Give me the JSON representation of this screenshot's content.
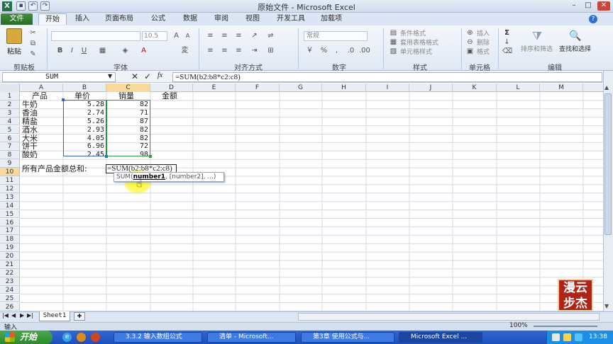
{
  "window": {
    "title": "原始文件 - Microsoft Excel",
    "controls": [
      "–",
      "□",
      "✕"
    ]
  },
  "ribbon_tabs": [
    "开始",
    "插入",
    "页面布局",
    "公式",
    "数据",
    "审阅",
    "视图",
    "开发工具",
    "加载项"
  ],
  "file_tab": "文件",
  "ribbon": {
    "paste": "粘贴",
    "groups": [
      "剪贴板",
      "字体",
      "对齐方式",
      "数字",
      "样式",
      "单元格",
      "编辑"
    ],
    "font_size": "10.5",
    "number_format": "常规",
    "styles_items": [
      "条件格式",
      "套用表格格式",
      "单元格样式"
    ],
    "cells_items": [
      "插入",
      "删除",
      "格式"
    ],
    "sort_filter": "排序和筛选",
    "find_select": "查找和选择",
    "sigma": "Σ"
  },
  "formula_bar": {
    "name_box": "SUM",
    "formula": "=SUM(b2:b8*c2:c8)"
  },
  "columns": [
    "A",
    "B",
    "C",
    "D",
    "E",
    "F",
    "G",
    "H",
    "I",
    "J",
    "K",
    "L",
    "M"
  ],
  "rows": [
    "1",
    "2",
    "3",
    "4",
    "5",
    "6",
    "7",
    "8",
    "9",
    "10",
    "11",
    "12",
    "13",
    "14",
    "15",
    "16",
    "17",
    "18",
    "19",
    "20",
    "21",
    "22",
    "23",
    "24",
    "25",
    "26"
  ],
  "table": {
    "headers": [
      "产品",
      "单价",
      "销量",
      "金额"
    ],
    "products": [
      "牛奶",
      "香油",
      "精盐",
      "酒水",
      "大米",
      "饼干",
      "酸奶"
    ],
    "prices": [
      "5.28",
      "2.74",
      "5.26",
      "2.93",
      "4.05",
      "6.96",
      "2.45"
    ],
    "sales": [
      "82",
      "71",
      "87",
      "82",
      "82",
      "72",
      "98"
    ]
  },
  "row10": {
    "label": "所有产品金额总和:",
    "edit_text": "=SUM(b2:b8*c2:c8)"
  },
  "tooltip": {
    "func": "SUM(",
    "arg1": "number1",
    "rest": ", [number2], ...)"
  },
  "sheet_tab": "Sheet1",
  "status": {
    "mode": "输入",
    "zoom": "100%"
  },
  "taskbar": {
    "start": "开始",
    "items": [
      "3.3.2 输入数组公式",
      "清单 - Microsoft...",
      "第3章 使用公式与...",
      "Microsoft Excel ..."
    ],
    "time": "13:38"
  },
  "watermark": "漫云步杰",
  "colors": {
    "selection_blue": "#3366cc",
    "selection_green": "#2e9e45",
    "file_tab_green": "#2e7d2a",
    "taskbar_blue": "#245ccc"
  }
}
